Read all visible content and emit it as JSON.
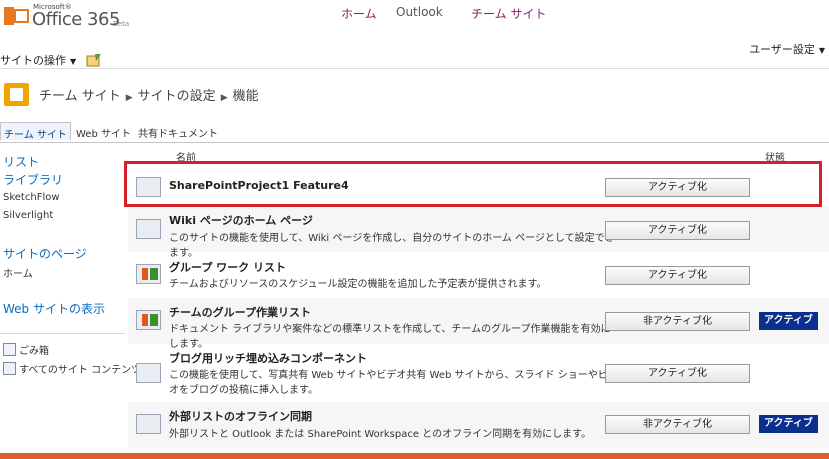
{
  "header": {
    "logo_small": "Microsoft®",
    "logo_name": "Office 365",
    "logo_beta": "Beta",
    "nav": [
      "ホーム",
      "Outlook",
      "チーム サイト"
    ],
    "site_actions": "サイトの操作",
    "user_settings": "ユーザー設定"
  },
  "breadcrumb": [
    "チーム サイト",
    "サイトの設定",
    "機能"
  ],
  "tabs": [
    "チーム サイト",
    "Web サイト",
    "共有ドキュメント"
  ],
  "quick_launch": {
    "lists_head": "リスト",
    "libraries_head": "ライブラリ",
    "library_items": [
      "SketchFlow",
      "Silverlight"
    ],
    "pages_head": "サイトのページ",
    "pages_items": [
      "ホーム"
    ],
    "web_sites_head": "Web サイトの表示",
    "recycle_bin": "ごみ箱",
    "all_content": "すべてのサイト コンテンツ"
  },
  "table": {
    "col_name": "名前",
    "col_status": "状態"
  },
  "features": [
    {
      "name": "SharePointProject1 Feature4",
      "desc": "",
      "button": "アクティブ化",
      "status": ""
    },
    {
      "name": "Wiki ページのホーム ページ",
      "desc": "このサイトの機能を使用して、Wiki ページを作成し、自分のサイトのホーム ページとして設定できます。",
      "button": "アクティブ化",
      "status": ""
    },
    {
      "name": "グループ ワーク リスト",
      "desc": "チームおよびリソースのスケジュール設定の機能を追加した予定表が提供されます。",
      "button": "アクティブ化",
      "status": ""
    },
    {
      "name": "チームのグループ作業リスト",
      "desc": "ドキュメント ライブラリや案件などの標準リストを作成して、チームのグループ作業機能を有効にします。",
      "button": "非アクティブ化",
      "status": "アクティブ"
    },
    {
      "name": "ブログ用リッチ埋め込みコンポーネント",
      "desc": "この機能を使用して、写真共有 Web サイトやビデオ共有 Web サイトから、スライド ショーやビデオをブログの投稿に挿入します。",
      "button": "アクティブ化",
      "status": ""
    },
    {
      "name": "外部リストのオフライン同期",
      "desc": "外部リストと Outlook または SharePoint Workspace とのオフライン同期を有効にします。",
      "button": "非アクティブ化",
      "status": "アクティブ"
    }
  ],
  "colors": {
    "accent_bar": "#d9612a",
    "highlight": "#d6202c",
    "badge": "#0a2f8c",
    "nav_link": "#8a1e66"
  }
}
